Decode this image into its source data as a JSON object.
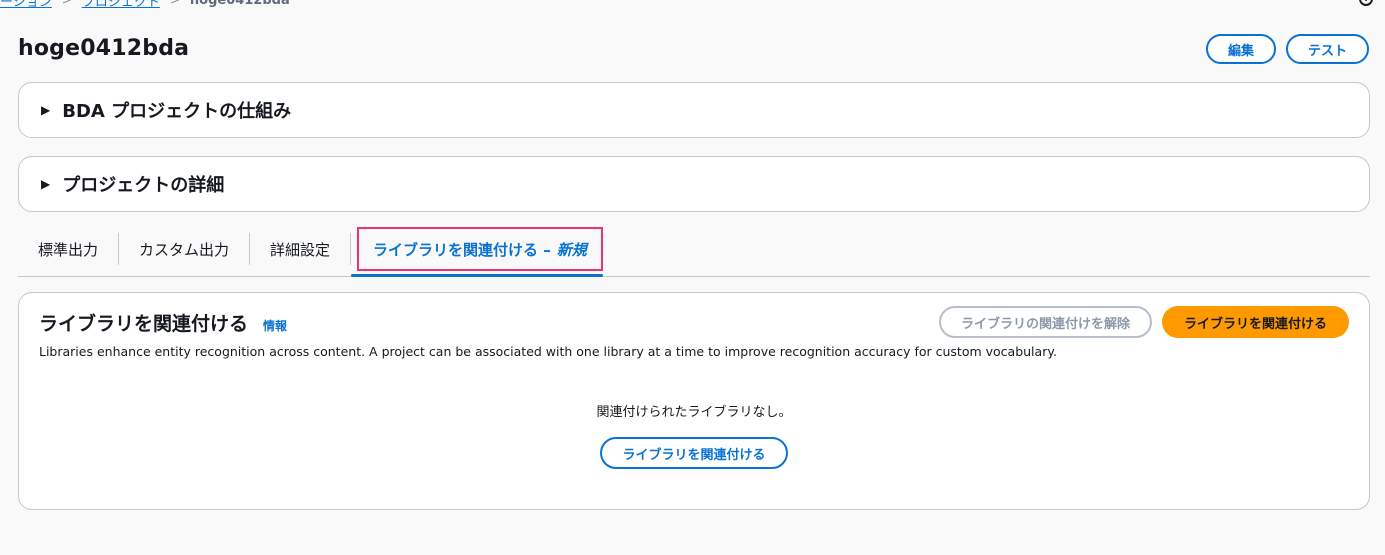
{
  "breadcrumb": {
    "items": [
      "ーション",
      "プロジェクト"
    ],
    "current": "hoge0412bda"
  },
  "page": {
    "title": "hoge0412bda",
    "edit_label": "編集",
    "test_label": "テスト"
  },
  "expanders": {
    "how_it_works": "BDA プロジェクトの仕組み",
    "details": "プロジェクトの詳細"
  },
  "tabs": {
    "standard_output": "標準出力",
    "custom_output": "カスタム出力",
    "advanced_settings": "詳細設定",
    "associate_library": "ライブラリを関連付ける –",
    "new_badge": "新規"
  },
  "panel": {
    "title": "ライブラリを関連付ける",
    "info_link": "情報",
    "description": "Libraries enhance entity recognition across content. A project can be associated with one library at a time to improve recognition accuracy for custom vocabulary.",
    "disassociate_label": "ライブラリの関連付けを解除",
    "associate_label": "ライブラリを関連付ける",
    "empty_text": "関連付けられたライブラリなし。",
    "empty_button_label": "ライブラリを関連付ける"
  },
  "colors": {
    "accent": "#0972d3",
    "primary_button": "#ff9900",
    "highlight_border": "#e8336b"
  }
}
